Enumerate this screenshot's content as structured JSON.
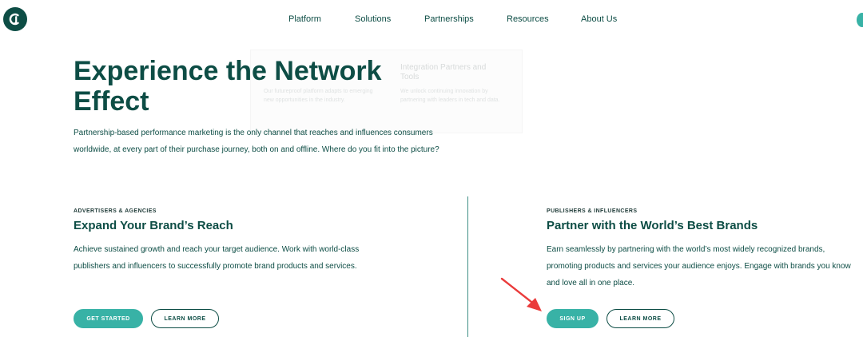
{
  "colors": {
    "brand_dark": "#0d4d45",
    "brand_accent": "#38b2a6",
    "annotation_arrow": "#ea3b3b"
  },
  "header": {
    "logo_icon": "cj-logo-icon",
    "nav": [
      "Platform",
      "Solutions",
      "Partnerships",
      "Resources",
      "About Us"
    ]
  },
  "dropdown": {
    "col2_title": "Integration Partners and Tools",
    "col1_text": "Our futureproof platform adapts to emerging new opportunities in the industry.",
    "col2_text": "We unlock continuing innovation by partnering with leaders in tech and data."
  },
  "hero": {
    "title": "Experience the Network Effect",
    "text": "Partnership-based performance marketing is the only channel that reaches and influences consumers worldwide, at every part of their purchase journey, both on and offline. Where do you fit into the picture?"
  },
  "advertisers": {
    "eyebrow": "ADVERTISERS & AGENCIES",
    "title": "Expand Your Brand’s Reach",
    "text": "Achieve sustained growth and reach your target audience. Work with world-class publishers and influencers to successfully promote brand products and services.",
    "primary_button": "GET STARTED",
    "secondary_button": "LEARN MORE"
  },
  "publishers": {
    "eyebrow": "PUBLISHERS & INFLUENCERS",
    "title": "Partner with the World’s Best Brands",
    "text": "Earn seamlessly by partnering with the world’s most widely recognized brands, promoting products and services your audience enjoys. Engage with brands you know and love all in one place.",
    "primary_button": "SIGN UP",
    "secondary_button": "LEARN MORE"
  }
}
